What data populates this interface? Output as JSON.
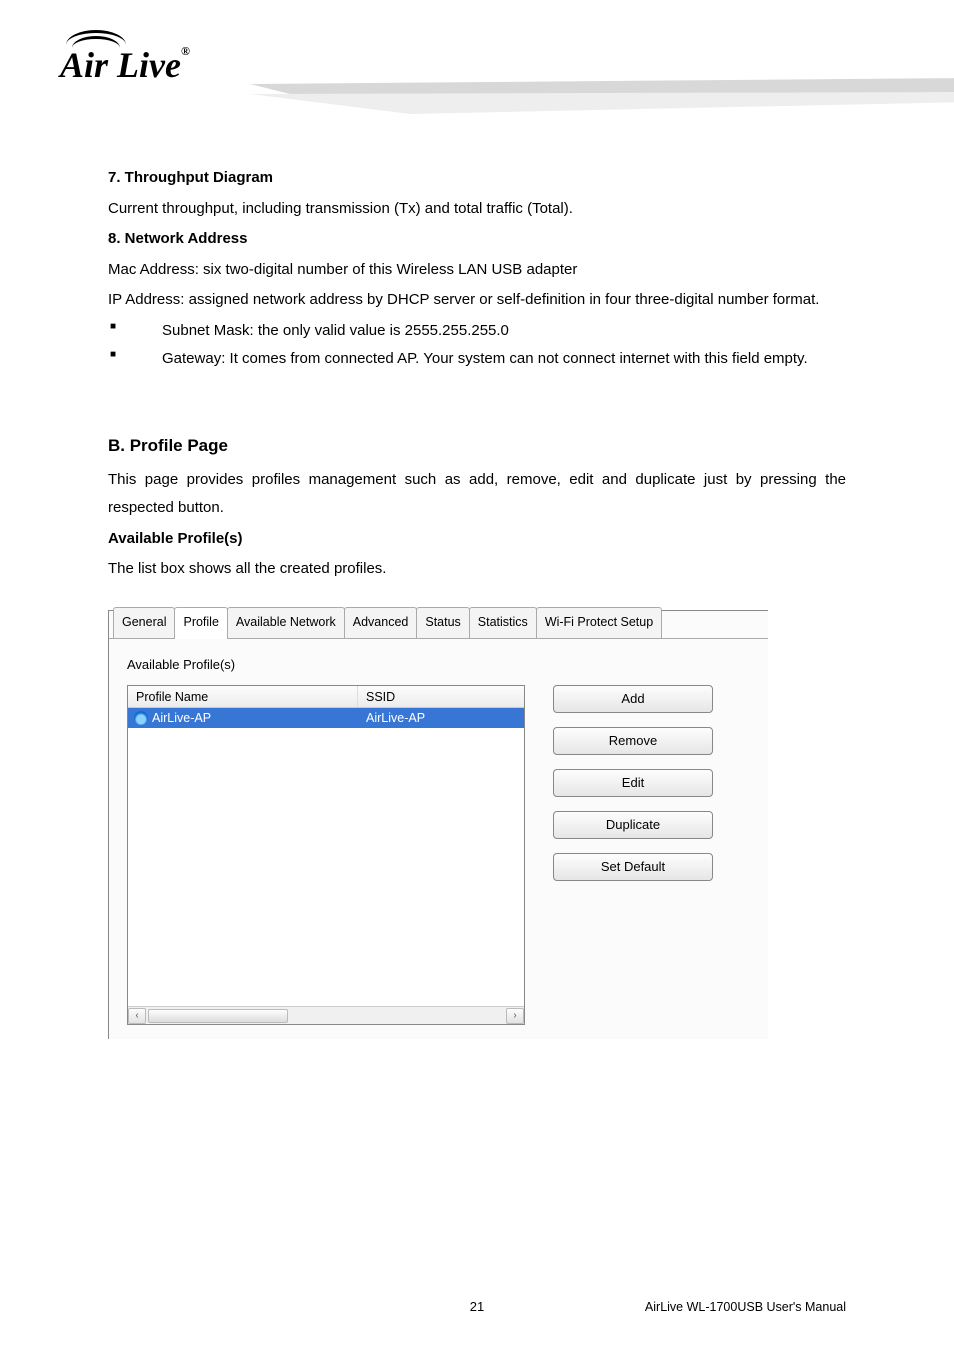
{
  "logo": {
    "text": "Air Live",
    "mark": "®"
  },
  "sections": {
    "s7": {
      "title": "7. Throughput Diagram",
      "body": "Current throughput, including transmission (Tx) and total traffic (Total)."
    },
    "s8": {
      "title": "8. Network Address",
      "mac": "Mac Address: six two-digital number of this Wireless LAN USB adapter",
      "ip": "IP Address: assigned network address by DHCP server or self-definition in four three-digital number format.",
      "bullets": [
        "Subnet Mask: the only valid value is 2555.255.255.0",
        "Gateway: It comes from connected AP. Your system can not connect internet with this field empty."
      ]
    },
    "b": {
      "title": "B. Profile Page",
      "body": "This page provides profiles management such as add, remove, edit and duplicate just by pressing the respected button.",
      "sub": "Available Profile(s)",
      "subbody": "The list box shows all the created profiles."
    }
  },
  "shot": {
    "tabs": [
      "General",
      "Profile",
      "Available Network",
      "Advanced",
      "Status",
      "Statistics",
      "Wi-Fi Protect Setup"
    ],
    "active_tab": 1,
    "panel_label": "Available Profile(s)",
    "columns": {
      "name": "Profile Name",
      "ssid": "SSID"
    },
    "rows": [
      {
        "name": "AirLive-AP",
        "ssid": "AirLive-AP",
        "selected": true
      }
    ],
    "buttons": [
      "Add",
      "Remove",
      "Edit",
      "Duplicate",
      "Set Default"
    ],
    "scroll": {
      "left": "‹",
      "right": "›",
      "thumb": "▪▪▪"
    }
  },
  "footer": {
    "page": "21",
    "right": "AirLive WL-1700USB User's Manual"
  }
}
